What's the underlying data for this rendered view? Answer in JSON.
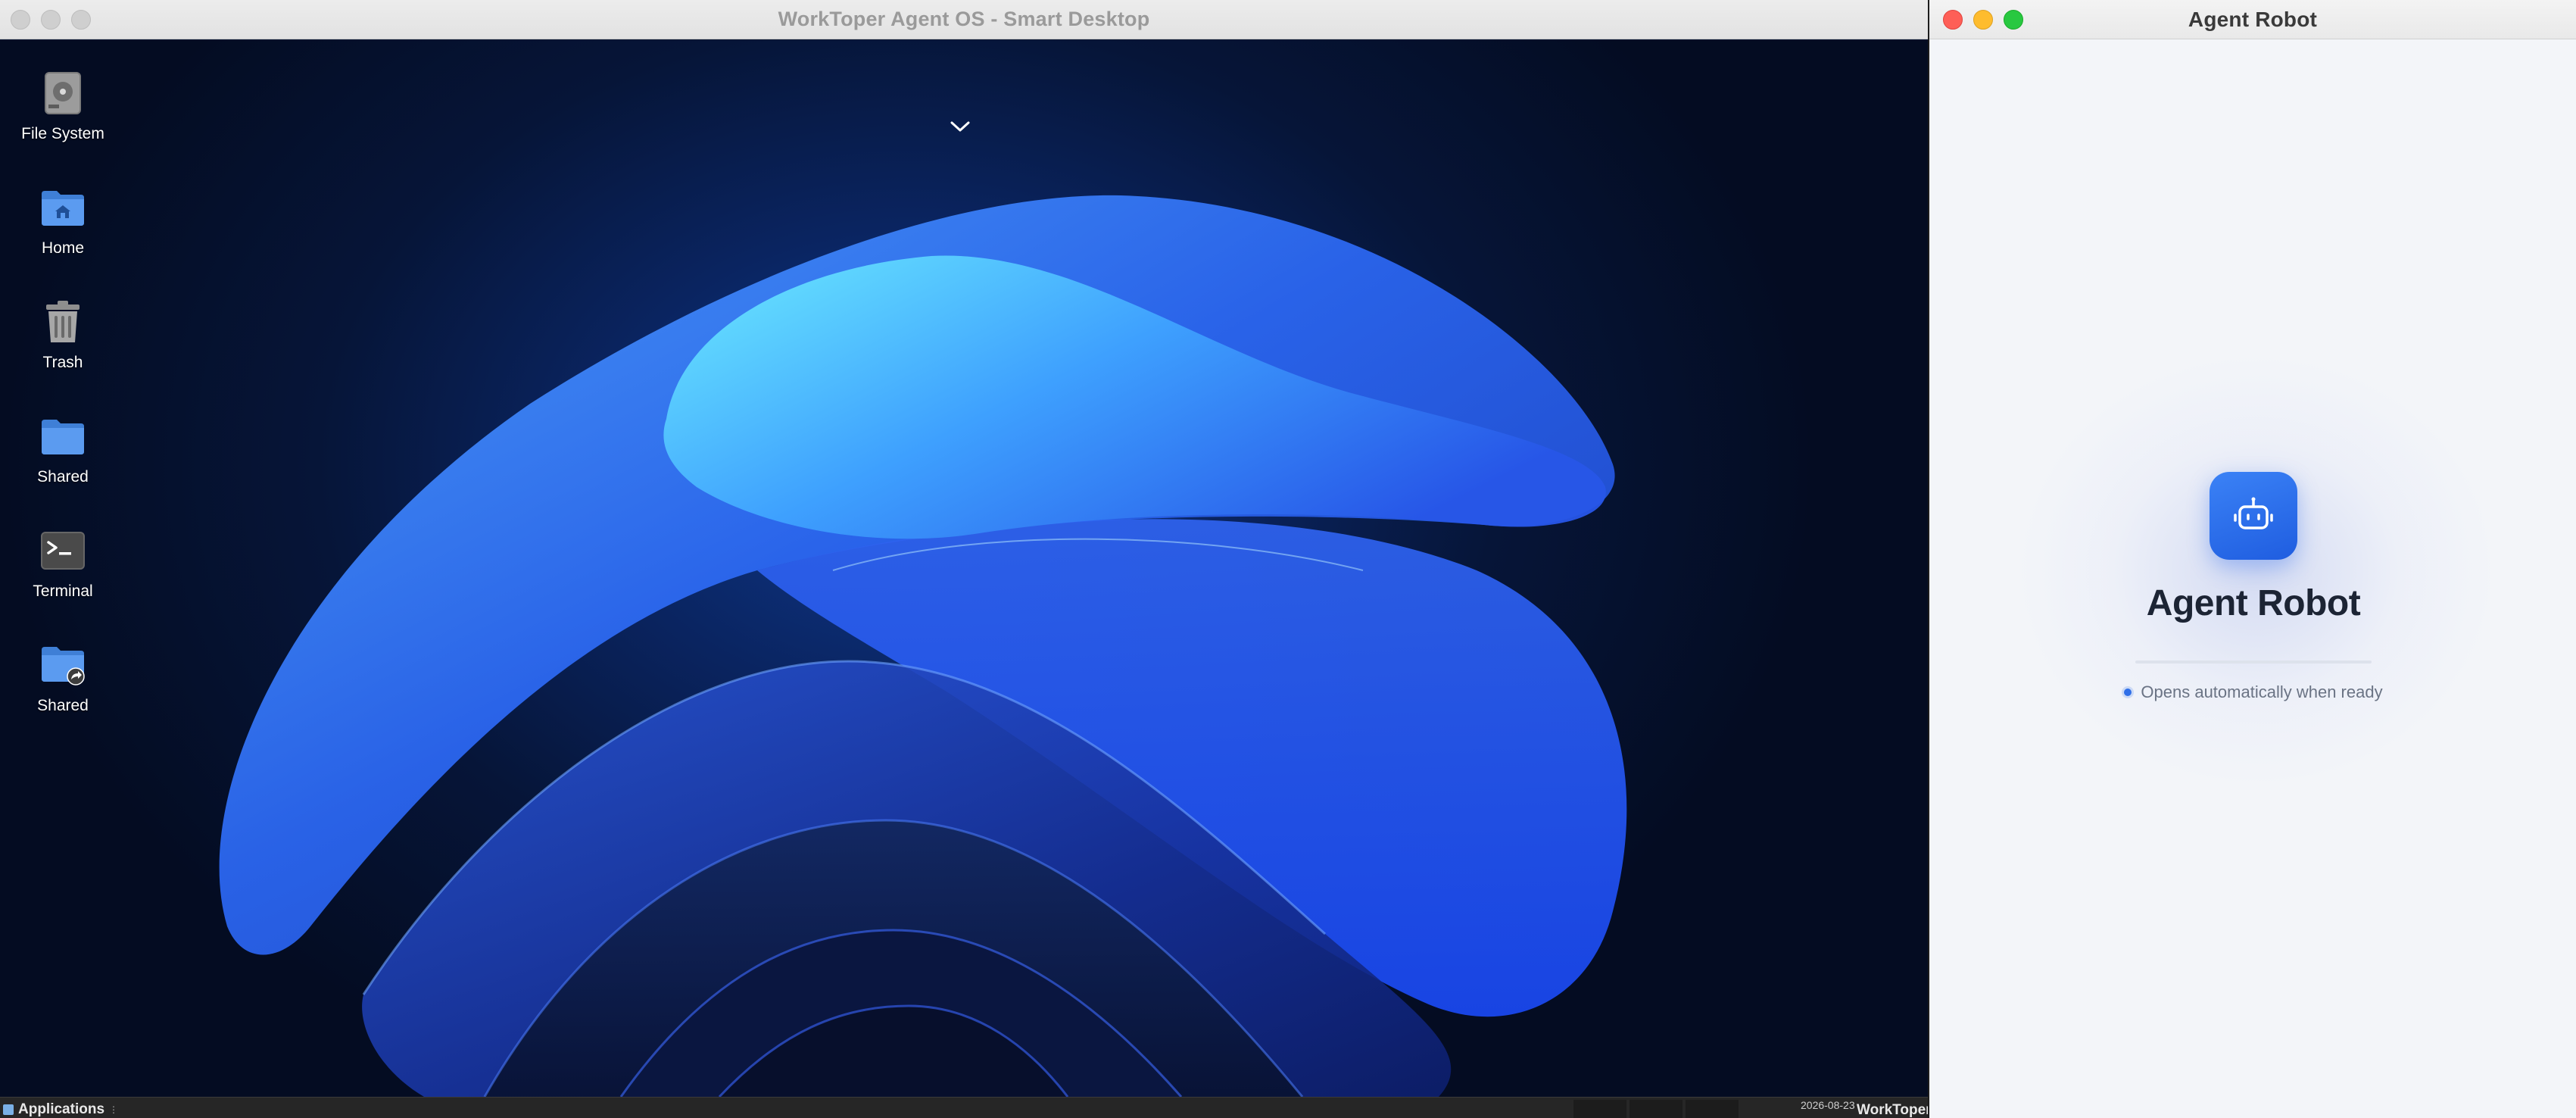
{
  "desktop_window": {
    "title": "WorkToper Agent OS - Smart Desktop",
    "icons": [
      {
        "label": "File System",
        "icon": "disk-icon"
      },
      {
        "label": "Home",
        "icon": "home-folder-icon"
      },
      {
        "label": "Trash",
        "icon": "trash-icon"
      },
      {
        "label": "Shared",
        "icon": "folder-icon"
      },
      {
        "label": "Terminal",
        "icon": "terminal-icon"
      },
      {
        "label": "Shared",
        "icon": "shared-folder-icon"
      }
    ],
    "taskbar": {
      "applications_label": "Applications",
      "date": "2026-08-23",
      "brand": "WorkToper"
    }
  },
  "agent_window": {
    "title": "Agent Robot",
    "app_name": "Agent Robot",
    "status_text": "Opens automatically when ready",
    "colors": {
      "accent": "#2563eb",
      "status_dot": "#2f6fe8"
    }
  }
}
